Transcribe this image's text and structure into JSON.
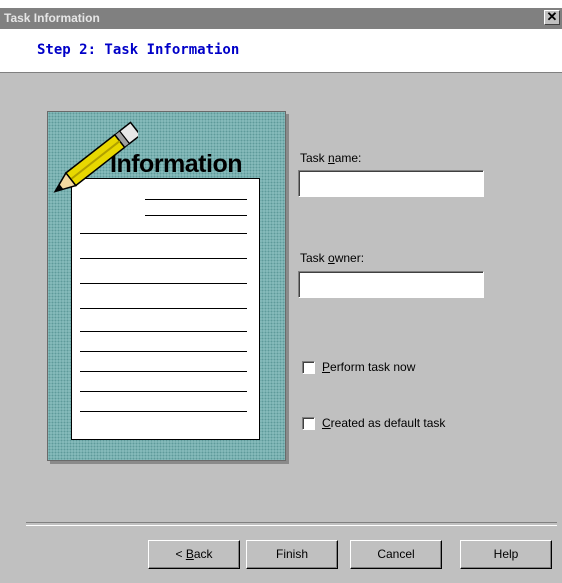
{
  "window": {
    "title": "Task Information",
    "close_glyph": "✕"
  },
  "header": {
    "title": "Step 2: Task Information"
  },
  "illustration": {
    "title": "Information",
    "icon": "pencil-icon"
  },
  "form": {
    "task_name": {
      "label_pre": "Task ",
      "label_key": "n",
      "label_post": "ame:",
      "value": ""
    },
    "task_owner": {
      "label_pre": "Task ",
      "label_key": "o",
      "label_post": "wner:",
      "value": ""
    },
    "perform_now": {
      "label_key": "P",
      "label_post": "erform task now",
      "checked": false
    },
    "default_task": {
      "label_key": "C",
      "label_post": "reated as default task",
      "checked": false
    }
  },
  "buttons": {
    "back": {
      "pre": "< ",
      "key": "B",
      "post": "ack"
    },
    "finish": "Finish",
    "cancel": "Cancel",
    "help": "Help"
  }
}
